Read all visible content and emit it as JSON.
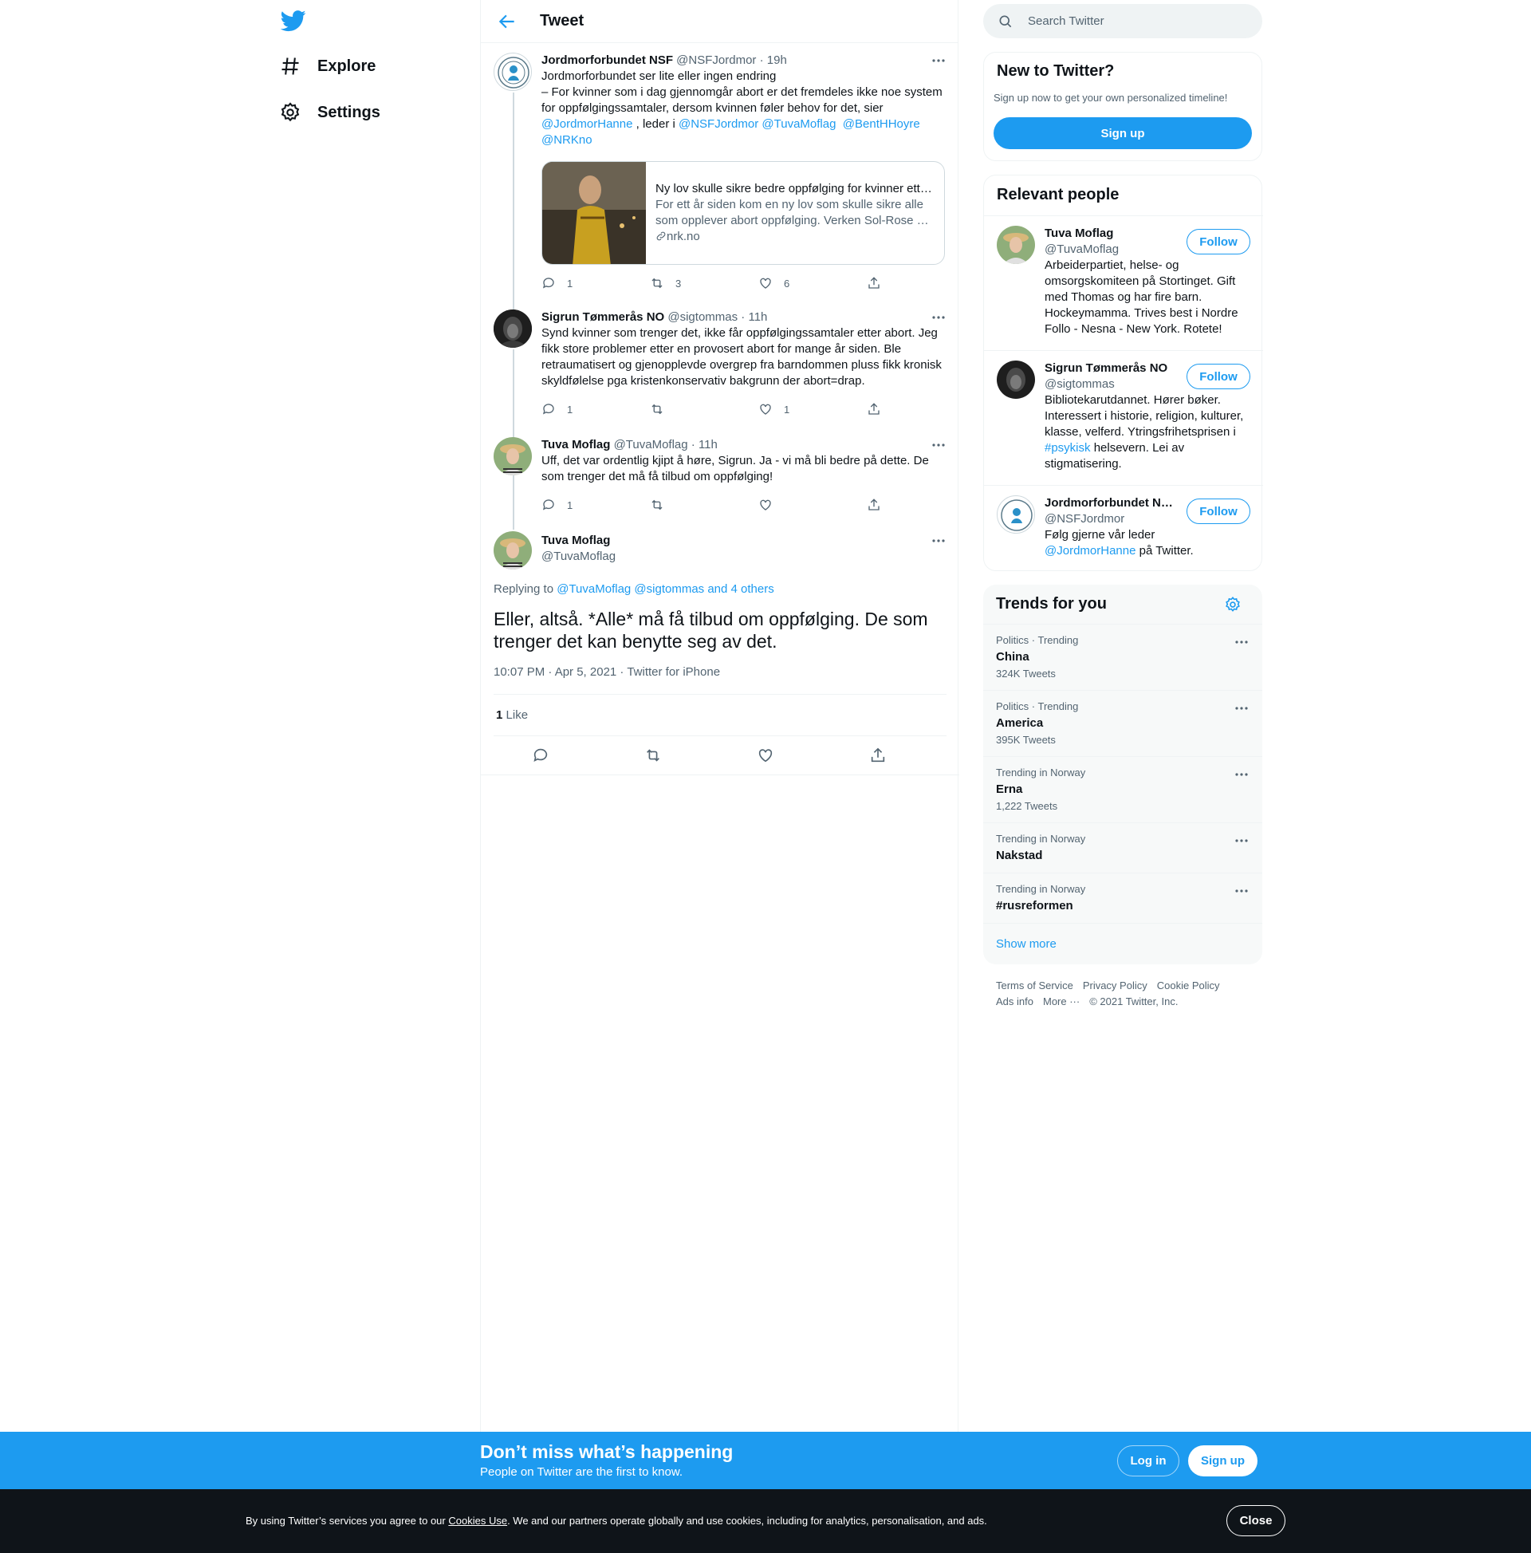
{
  "nav": {
    "explore": "Explore",
    "settings": "Settings"
  },
  "header": {
    "title": "Tweet"
  },
  "thread": [
    {
      "name": "Jordmorforbundet NSF",
      "handle": "@NSFJordmor",
      "time": "· 19h",
      "lines": [
        "Jordmorforbundet ser lite eller ingen endring",
        "– For kvinner som i dag gjennomgår abort er det fremdeles ikke noe system",
        "for oppfølgingssamtaler, dersom kvinnen føler behov for det, sier"
      ],
      "mention1": "@JordmorHanne",
      "mid": " , leder i ",
      "mention2": "@NSFJordmor",
      "mention3": "@TuvaMoflag",
      "mention4": "@BentHHoyre",
      "mention5": "@NRKno",
      "card": {
        "title": "Ny lov skulle sikre bedre oppfølging for kvinner ett…",
        "line1": "For ett år siden kom en ny lov som skulle sikre alle",
        "line2": "som opplever abort oppfølging. Verken Sol-Rose …",
        "domain": "nrk.no"
      },
      "replies": "1",
      "retweets": "3",
      "likes": "6"
    },
    {
      "name": "Sigrun Tømmerås NO",
      "handle": "@sigtommas",
      "time": "· 11h",
      "lines": [
        "Synd kvinner som trenger det, ikke får oppfølgingssamtaler etter abort. Jeg",
        "fikk store problemer etter en provosert abort for mange år siden. Ble",
        "retraumatisert og gjenopplevde overgrep fra barndommen pluss fikk kronisk",
        "skyldfølelse pga kristenkonservativ bakgrunn der abort=drap."
      ],
      "replies": "1",
      "retweets": "",
      "likes": "1"
    },
    {
      "name": "Tuva Moflag",
      "handle": "@TuvaMoflag",
      "time": "· 11h",
      "lines": [
        "Uff, det var ordentlig kjipt å høre, Sigrun. Ja - vi må bli bedre på dette. De",
        "som trenger det må få tilbud om oppfølging!"
      ],
      "replies": "1",
      "retweets": "",
      "likes": ""
    }
  ],
  "focus": {
    "name": "Tuva Moflag",
    "handle": "@TuvaMoflag",
    "replying_prefix": "Replying to",
    "replying_users": "@TuvaMoflag @sigtommas and 4 others",
    "text_line1": "Eller, altså. *Alle* må få tilbud om oppfølging. De som",
    "text_line2": "trenger det kan benytte seg av det.",
    "meta": "10:07 PM · Apr 5, 2021 · Twitter for iPhone",
    "like_count": "1",
    "like_label": "Like"
  },
  "search": {
    "placeholder": "Search Twitter"
  },
  "new_to_twitter": {
    "title": "New to Twitter?",
    "subtitle": "Sign up now to get your own personalized timeline!",
    "button": "Sign up"
  },
  "relevant": {
    "title": "Relevant people",
    "people": [
      {
        "name": "Tuva Moflag",
        "handle": "@TuvaMoflag",
        "bio": [
          "Arbeiderpartiet, helse- og",
          "omsorgskomiteen på Stortinget. Gift",
          "med Thomas og har fire barn.",
          "Hockeymamma. Trives best i Nordre",
          "Follo - Nesna - New York. Rotete!"
        ],
        "follow": "Follow"
      },
      {
        "name": "Sigrun Tømmerås NO",
        "handle": "@sigtommas",
        "bio_a": "Bibliotekarutdannet. Hører bøker.",
        "bio_b": "Interessert i historie, religion, kulturer,",
        "bio_c": "klasse, velferd. Ytringsfrihetsprisen i",
        "hashtag": "#psykisk",
        "bio_d": " helsevern. Lei av",
        "bio_e": "stigmatisering.",
        "follow": "Follow"
      },
      {
        "name": "Jordmorforbundet N…",
        "handle": "@NSFJordmor",
        "bio_a": "Følg gjerne vår leder",
        "mention": "@JordmorHanne",
        "bio_b": " på Twitter.",
        "follow": "Follow"
      }
    ]
  },
  "trends": {
    "title": "Trends for you",
    "items": [
      {
        "meta": "Politics · Trending",
        "name": "China",
        "count": "324K Tweets"
      },
      {
        "meta": "Politics · Trending",
        "name": "America",
        "count": "395K Tweets"
      },
      {
        "meta": "Trending in Norway",
        "name": "Erna",
        "count": "1,222 Tweets"
      },
      {
        "meta": "Trending in Norway",
        "name": "Nakstad",
        "count": ""
      },
      {
        "meta": "Trending in Norway",
        "name": "#rusreformen",
        "count": ""
      }
    ],
    "show_more": "Show more"
  },
  "footer": {
    "terms": "Terms of Service",
    "privacy": "Privacy Policy",
    "cookie": "Cookie Policy",
    "ads": "Ads info",
    "more": "More ···",
    "copyright": "© 2021 Twitter, Inc."
  },
  "banner": {
    "title": "Don’t miss what’s happening",
    "subtitle": "People on Twitter are the first to know.",
    "login": "Log in",
    "signup": "Sign up"
  },
  "cookie": {
    "prefix": "By using Twitter’s services you agree to our ",
    "link": "Cookies Use",
    "suffix": ". We and our partners operate globally and use cookies, including for analytics, personalisation, and ads.",
    "close": "Close"
  },
  "colors": {
    "accent": "#1d9bf0",
    "text": "#0f1419",
    "muted": "#536471",
    "border": "#eff3f4"
  }
}
